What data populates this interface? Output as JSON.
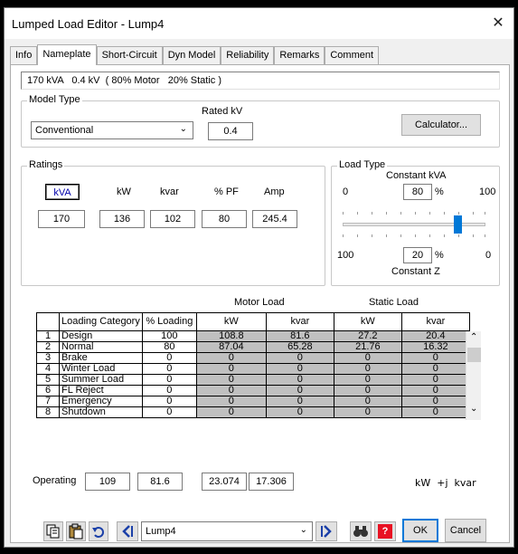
{
  "window": {
    "title": "Lumped Load Editor - Lump4",
    "close_glyph": "✕"
  },
  "tabs": [
    "Info",
    "Nameplate",
    "Short-Circuit",
    "Dyn Model",
    "Reliability",
    "Remarks",
    "Comment"
  ],
  "active_tab": "Nameplate",
  "summary": "170 kVA   0.4 kV  ( 80% Motor   20% Static )",
  "model_type": {
    "label": "Model Type",
    "selected": "Conventional",
    "rated_kv_label": "Rated kV",
    "rated_kv": "0.4",
    "calculator_label": "Calculator..."
  },
  "ratings": {
    "label": "Ratings",
    "headers": [
      "kVA",
      "kW",
      "kvar",
      "% PF",
      "Amp"
    ],
    "values": [
      "170",
      "136",
      "102",
      "80",
      "245.4"
    ],
    "selected_header": "kVA"
  },
  "load_type": {
    "label": "Load Type",
    "constant_kva_label": "Constant kVA",
    "left_min": "0",
    "right_max": "100",
    "kva_percent": "80",
    "percent_sign": "%",
    "left_bottom": "100",
    "right_bottom": "0",
    "z_percent": "20",
    "constant_z_label": "Constant Z",
    "slider_value_percent": 80
  },
  "loading_table": {
    "motor_load_label": "Motor Load",
    "static_load_label": "Static Load",
    "headers": [
      "Loading Category",
      "% Loading",
      "kW",
      "kvar",
      "kW",
      "kvar"
    ],
    "rows": [
      {
        "idx": "1",
        "category": "Design",
        "loading": "100",
        "motor_kw": "108.8",
        "motor_kvar": "81.6",
        "static_kw": "27.2",
        "static_kvar": "20.4"
      },
      {
        "idx": "2",
        "category": "Normal",
        "loading": "80",
        "motor_kw": "87.04",
        "motor_kvar": "65.28",
        "static_kw": "21.76",
        "static_kvar": "16.32"
      },
      {
        "idx": "3",
        "category": "Brake",
        "loading": "0",
        "motor_kw": "0",
        "motor_kvar": "0",
        "static_kw": "0",
        "static_kvar": "0"
      },
      {
        "idx": "4",
        "category": "Winter Load",
        "loading": "0",
        "motor_kw": "0",
        "motor_kvar": "0",
        "static_kw": "0",
        "static_kvar": "0"
      },
      {
        "idx": "5",
        "category": "Summer Load",
        "loading": "0",
        "motor_kw": "0",
        "motor_kvar": "0",
        "static_kw": "0",
        "static_kvar": "0"
      },
      {
        "idx": "6",
        "category": "FL Reject",
        "loading": "0",
        "motor_kw": "0",
        "motor_kvar": "0",
        "static_kw": "0",
        "static_kvar": "0"
      },
      {
        "idx": "7",
        "category": "Emergency",
        "loading": "0",
        "motor_kw": "0",
        "motor_kvar": "0",
        "static_kw": "0",
        "static_kvar": "0"
      },
      {
        "idx": "8",
        "category": "Shutdown",
        "loading": "0",
        "motor_kw": "0",
        "motor_kvar": "0",
        "static_kw": "0",
        "static_kvar": "0"
      }
    ]
  },
  "operating": {
    "label": "Operating",
    "values": [
      "109",
      "81.6",
      "23.074",
      "17.306"
    ],
    "units": "kW  +j  kvar"
  },
  "bottom": {
    "element_selected": "Lump4",
    "ok_label": "OK",
    "cancel_label": "Cancel",
    "help_glyph": "?",
    "binoculars_glyph": "🔭"
  },
  "colors": {
    "accent": "#0078d7",
    "calc_cell": "#c0c0c0",
    "help_red": "#e81123"
  }
}
